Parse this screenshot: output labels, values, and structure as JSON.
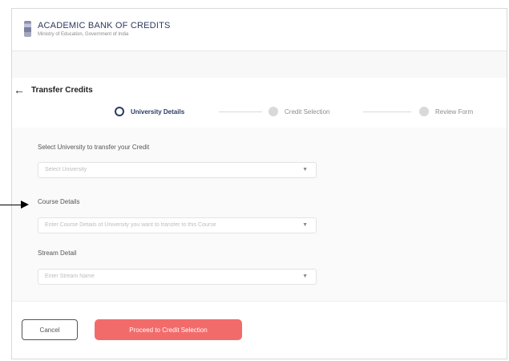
{
  "header": {
    "brand_title": "ACADEMIC BANK OF CREDITS",
    "brand_subtitle": "Ministry of Education, Government of India"
  },
  "page": {
    "back_icon": "arrow-left-icon",
    "title": "Transfer Credits"
  },
  "stepper": {
    "steps": [
      {
        "label": "University Details",
        "state": "active"
      },
      {
        "label": "Credit Selection",
        "state": "inactive"
      },
      {
        "label": "Review Form",
        "state": "inactive"
      }
    ]
  },
  "form": {
    "university": {
      "label": "Select University to transfer your Credit",
      "placeholder": "Select University"
    },
    "course": {
      "label": "Course Details",
      "placeholder": "Enter Course Details of University you want to transfer to this Course"
    },
    "stream": {
      "label": "Stream Detail",
      "placeholder": "Enter Stream Name"
    }
  },
  "footer": {
    "cancel_label": "Cancel",
    "proceed_label": "Proceed to Credit Selection"
  },
  "colors": {
    "primary": "#2b3a67",
    "accent": "#f26b6b"
  }
}
